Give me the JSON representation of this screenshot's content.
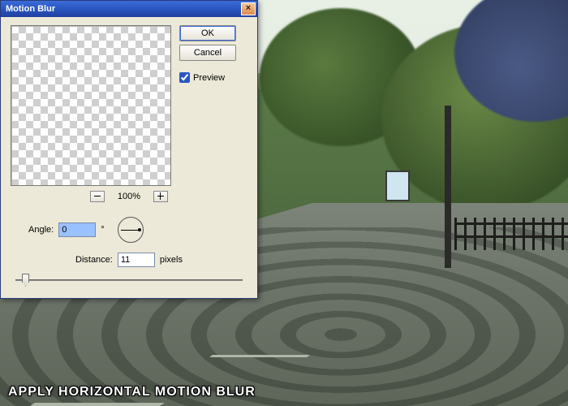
{
  "dialog": {
    "title": "Motion Blur",
    "ok_label": "OK",
    "cancel_label": "Cancel",
    "preview_label": "Preview",
    "preview_checked": true,
    "zoom_label": "100%",
    "angle_label": "Angle:",
    "angle_value": "0",
    "angle_unit": "°",
    "distance_label": "Distance:",
    "distance_value": "11",
    "distance_unit": "pixels",
    "close_glyph": "×",
    "minus_glyph": "−",
    "plus_glyph": "+"
  },
  "caption": "APPLY HORIZONTAL MOTION BLUR"
}
